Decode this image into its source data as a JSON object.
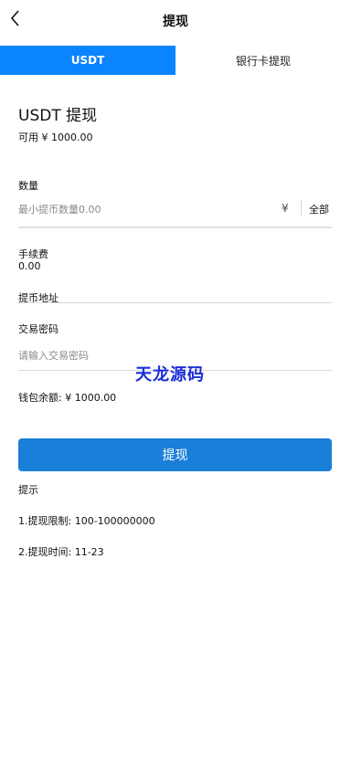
{
  "header": {
    "title": "提现",
    "back_icon": "chevron-left-icon"
  },
  "tabs": [
    {
      "label": "USDT",
      "active": true
    },
    {
      "label": "银行卡提现",
      "active": false
    }
  ],
  "form": {
    "section_title": "USDT 提现",
    "available": "可用 ¥ 1000.00",
    "amount_label": "数量",
    "amount_placeholder": "最小提币数量0.00",
    "currency_symbol": "¥",
    "all_label": "全部",
    "fee_label": "手续费",
    "fee_value": "0.00",
    "address_label": "提币地址",
    "address_value": "",
    "password_label": "交易密码",
    "password_placeholder": "请输入交易密码",
    "wallet_balance": "钱包余额: ¥ 1000.00",
    "submit_label": "提现"
  },
  "watermark": "天龙源码",
  "tips": {
    "title": "提示",
    "limit": "1.提现限制: 100-100000000",
    "time": "2.提现时间: 11-23"
  },
  "colors": {
    "tab_active": "#0a84ff",
    "submit": "#1a7fd8",
    "watermark": "#1a2cd8"
  }
}
